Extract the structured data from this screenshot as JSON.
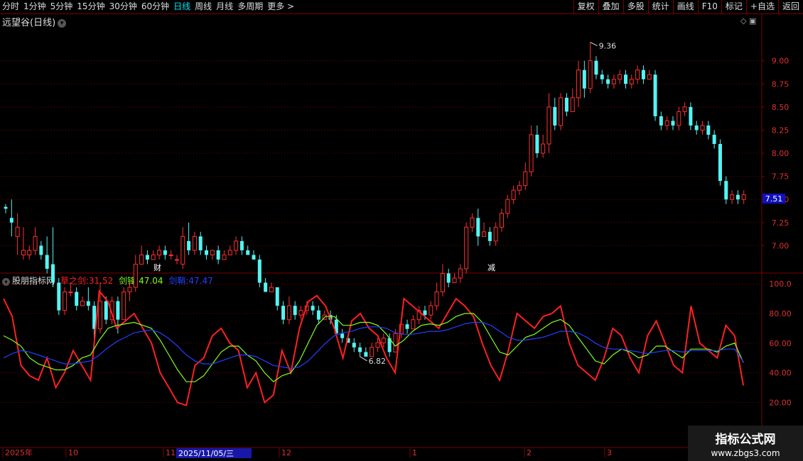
{
  "toolbar": {
    "periods": [
      "分时",
      "1分钟",
      "5分钟",
      "15分钟",
      "30分钟",
      "60分钟",
      "日线",
      "周线",
      "月线",
      "多周期",
      "更多 >"
    ],
    "active_period": "日线",
    "tools": [
      "复权",
      "叠加",
      "多股",
      "统计",
      "画线",
      "F10",
      "标记",
      "+自选",
      "返回"
    ]
  },
  "stock": {
    "title": "远望谷(日线)",
    "current_price": "7.51",
    "high_label": "9.36",
    "low_label": "6.82"
  },
  "markers": {
    "cai": "财",
    "jian": "减"
  },
  "indicator": {
    "name": "股朋指标网",
    "lines": [
      {
        "label": "草之剑:",
        "value": "31.52",
        "color": "#ff2020"
      },
      {
        "label": "剑锋:",
        "value": "47.04",
        "color": "#80ff20"
      },
      {
        "label": "剑鞘:",
        "value": "47.47",
        "color": "#2040ff"
      }
    ]
  },
  "price_axis": [
    "9.00",
    "8.75",
    "8.50",
    "8.25",
    "8.00",
    "7.75",
    "7.50",
    "7.25",
    "7.00"
  ],
  "ind_axis": [
    "100.0",
    "80.00",
    "60.00",
    "40.00",
    "20.00"
  ],
  "date_axis": {
    "labels": [
      "2025年",
      "10",
      "11",
      "12",
      "1",
      "2",
      "3"
    ],
    "cursor_date": "2025/11/05/三"
  },
  "watermark": {
    "line1": "指标公式网",
    "line2": "www.zbgs3.com"
  },
  "colors": {
    "up": "#ff3030",
    "down": "#54f4f4",
    "grid": "#7a0000",
    "line_fast": "#ff2020",
    "line_mid": "#80ff20",
    "line_slow": "#2040ff"
  },
  "chart_data": {
    "type": "candlestick",
    "candles": [
      [
        7.42,
        7.4,
        7.45,
        7.35
      ],
      [
        7.3,
        7.25,
        7.5,
        7.1
      ],
      [
        7.1,
        7.2,
        7.35,
        6.9
      ],
      [
        6.9,
        6.95,
        7.2,
        6.85
      ],
      [
        6.9,
        6.95,
        7.0,
        6.85
      ],
      [
        6.95,
        7.1,
        7.2,
        6.9
      ],
      [
        7.0,
        6.9,
        7.05,
        6.85
      ],
      [
        6.9,
        6.75,
        7.1,
        6.7
      ],
      [
        6.8,
        6.6,
        7.2,
        6.55
      ],
      [
        6.6,
        6.3,
        6.65,
        6.25
      ],
      [
        6.3,
        6.5,
        6.55,
        6.25
      ],
      [
        6.5,
        6.5,
        6.6,
        6.45
      ],
      [
        6.5,
        6.35,
        6.55,
        6.3
      ],
      [
        6.35,
        6.4,
        6.45,
        6.35
      ],
      [
        6.4,
        6.35,
        6.55,
        6.3
      ],
      [
        6.35,
        6.1,
        6.4,
        5.95
      ],
      [
        6.1,
        6.4,
        6.6,
        6.05
      ],
      [
        6.4,
        6.2,
        6.45,
        6.15
      ],
      [
        6.2,
        6.4,
        6.45,
        6.15
      ],
      [
        6.4,
        6.2,
        6.45,
        6.05
      ],
      [
        6.2,
        6.5,
        6.55,
        6.2
      ],
      [
        6.5,
        6.55,
        6.6,
        6.4
      ],
      [
        6.55,
        6.8,
        6.9,
        6.5
      ],
      [
        6.8,
        6.9,
        7.0,
        6.8
      ],
      [
        6.9,
        6.85,
        6.95,
        6.8
      ],
      [
        6.85,
        6.9,
        6.95,
        6.85
      ],
      [
        6.9,
        6.95,
        7.0,
        6.85
      ],
      [
        6.95,
        6.9,
        7.0,
        6.85
      ],
      [
        6.9,
        6.9,
        6.95,
        6.85
      ],
      [
        6.85,
        6.85,
        6.9,
        6.8
      ],
      [
        6.8,
        7.1,
        7.2,
        6.75
      ],
      [
        7.05,
        6.95,
        7.25,
        6.9
      ],
      [
        6.95,
        7.1,
        7.15,
        6.9
      ],
      [
        7.1,
        6.95,
        7.15,
        6.9
      ],
      [
        6.95,
        6.9,
        7.0,
        6.85
      ],
      [
        6.9,
        6.95,
        6.95,
        6.85
      ],
      [
        6.95,
        6.85,
        7.0,
        6.8
      ],
      [
        6.85,
        6.9,
        6.95,
        6.85
      ],
      [
        6.9,
        6.95,
        7.0,
        6.9
      ],
      [
        6.95,
        7.05,
        7.1,
        6.9
      ],
      [
        7.05,
        6.95,
        7.1,
        6.9
      ],
      [
        6.95,
        6.9,
        7.0,
        6.9
      ],
      [
        6.9,
        6.85,
        6.95,
        6.85
      ],
      [
        6.85,
        6.6,
        6.9,
        6.55
      ],
      [
        6.6,
        6.5,
        6.65,
        6.5
      ],
      [
        6.5,
        6.55,
        6.6,
        6.5
      ],
      [
        6.55,
        6.35,
        6.55,
        6.3
      ],
      [
        6.35,
        6.2,
        6.4,
        6.15
      ],
      [
        6.2,
        6.35,
        6.45,
        6.15
      ],
      [
        6.35,
        6.25,
        6.4,
        6.2
      ],
      [
        6.25,
        6.3,
        6.35,
        6.2
      ],
      [
        6.3,
        6.35,
        6.4,
        6.25
      ],
      [
        6.35,
        6.3,
        6.4,
        6.25
      ],
      [
        6.3,
        6.2,
        6.35,
        6.15
      ],
      [
        6.2,
        6.25,
        6.3,
        6.2
      ],
      [
        6.25,
        6.2,
        6.3,
        6.15
      ],
      [
        6.2,
        6.05,
        6.25,
        6.05
      ],
      [
        6.05,
        6.0,
        6.1,
        5.95
      ],
      [
        6.0,
        5.95,
        6.05,
        5.95
      ],
      [
        5.95,
        5.9,
        6.0,
        5.85
      ],
      [
        5.9,
        5.85,
        5.95,
        5.8
      ],
      [
        5.85,
        5.8,
        5.9,
        5.8
      ],
      [
        5.8,
        5.9,
        5.95,
        5.8
      ],
      [
        5.9,
        5.95,
        6.0,
        5.85
      ],
      [
        5.95,
        6.0,
        6.05,
        5.9
      ],
      [
        6.0,
        5.85,
        6.05,
        5.8
      ],
      [
        5.85,
        6.05,
        6.1,
        5.85
      ],
      [
        6.05,
        6.15,
        6.2,
        6.0
      ],
      [
        6.15,
        6.1,
        6.2,
        6.05
      ],
      [
        6.1,
        6.2,
        6.25,
        6.1
      ],
      [
        6.2,
        6.3,
        6.35,
        6.15
      ],
      [
        6.3,
        6.25,
        6.35,
        6.2
      ],
      [
        6.25,
        6.35,
        6.4,
        6.2
      ],
      [
        6.35,
        6.5,
        6.6,
        6.3
      ],
      [
        6.5,
        6.7,
        6.8,
        6.45
      ],
      [
        6.7,
        6.6,
        6.75,
        6.55
      ],
      [
        6.6,
        6.65,
        6.7,
        6.6
      ],
      [
        6.65,
        6.75,
        6.8,
        6.6
      ],
      [
        6.75,
        7.2,
        7.25,
        6.7
      ],
      [
        7.2,
        7.3,
        7.35,
        7.15
      ],
      [
        7.3,
        7.1,
        7.4,
        7.0
      ],
      [
        7.1,
        7.15,
        7.25,
        7.1
      ],
      [
        7.15,
        7.05,
        7.2,
        7.0
      ],
      [
        7.05,
        7.2,
        7.25,
        7.0
      ],
      [
        7.2,
        7.35,
        7.4,
        7.15
      ],
      [
        7.35,
        7.5,
        7.55,
        7.3
      ],
      [
        7.5,
        7.6,
        7.65,
        7.45
      ],
      [
        7.6,
        7.65,
        7.7,
        7.55
      ],
      [
        7.65,
        7.8,
        7.9,
        7.6
      ],
      [
        7.8,
        8.2,
        8.3,
        7.75
      ],
      [
        8.2,
        8.0,
        8.3,
        7.95
      ],
      [
        8.0,
        8.1,
        8.2,
        7.95
      ],
      [
        8.1,
        8.5,
        8.65,
        8.0
      ],
      [
        8.5,
        8.3,
        8.6,
        8.25
      ],
      [
        8.3,
        8.6,
        8.65,
        8.25
      ],
      [
        8.6,
        8.45,
        8.65,
        8.4
      ],
      [
        8.45,
        8.6,
        8.7,
        8.45
      ],
      [
        8.6,
        8.9,
        9.0,
        8.5
      ],
      [
        8.9,
        8.7,
        9.0,
        8.6
      ],
      [
        8.7,
        9.0,
        9.2,
        8.65
      ],
      [
        9.0,
        8.85,
        9.05,
        8.8
      ],
      [
        8.85,
        8.8,
        8.9,
        8.75
      ],
      [
        8.8,
        8.75,
        8.85,
        8.7
      ],
      [
        8.75,
        8.8,
        8.85,
        8.7
      ],
      [
        8.8,
        8.85,
        8.9,
        8.75
      ],
      [
        8.85,
        8.75,
        8.9,
        8.7
      ],
      [
        8.75,
        8.8,
        8.85,
        8.7
      ],
      [
        8.8,
        8.9,
        8.95,
        8.75
      ],
      [
        8.9,
        8.8,
        8.95,
        8.75
      ],
      [
        8.8,
        8.85,
        8.9,
        8.8
      ],
      [
        8.85,
        8.4,
        8.9,
        8.35
      ],
      [
        8.4,
        8.3,
        8.45,
        8.25
      ],
      [
        8.3,
        8.35,
        8.4,
        8.25
      ],
      [
        8.35,
        8.3,
        8.4,
        8.25
      ],
      [
        8.3,
        8.45,
        8.5,
        8.25
      ],
      [
        8.45,
        8.5,
        8.55,
        8.4
      ],
      [
        8.5,
        8.3,
        8.55,
        8.25
      ],
      [
        8.3,
        8.25,
        8.35,
        8.2
      ],
      [
        8.25,
        8.3,
        8.35,
        8.2
      ],
      [
        8.3,
        8.2,
        8.35,
        8.15
      ],
      [
        8.2,
        8.1,
        8.25,
        8.05
      ],
      [
        8.1,
        7.7,
        8.15,
        7.65
      ],
      [
        7.7,
        7.5,
        7.75,
        7.45
      ],
      [
        7.5,
        7.55,
        7.6,
        7.45
      ],
      [
        7.55,
        7.5,
        7.6,
        7.45
      ],
      [
        7.5,
        7.55,
        7.6,
        7.45
      ]
    ],
    "indicator_series": {
      "草之剑": [
        90,
        78,
        45,
        38,
        35,
        50,
        30,
        40,
        55,
        45,
        35,
        95,
        88,
        70,
        75,
        80,
        70,
        60,
        40,
        30,
        20,
        18,
        45,
        50,
        65,
        70,
        60,
        55,
        30,
        40,
        20,
        25,
        55,
        40,
        70,
        88,
        92,
        85,
        70,
        50,
        75,
        80,
        70,
        65,
        50,
        40,
        90,
        85,
        80,
        75,
        70,
        80,
        90,
        85,
        78,
        60,
        45,
        35,
        55,
        80,
        75,
        70,
        78,
        80,
        85,
        60,
        45,
        40,
        35,
        50,
        70,
        65,
        50,
        40,
        65,
        75,
        60,
        45,
        40,
        85,
        60,
        55,
        50,
        72,
        65,
        31.52
      ],
      "剑锋": [
        65,
        62,
        58,
        50,
        46,
        44,
        42,
        42,
        45,
        50,
        52,
        62,
        70,
        72,
        73,
        74,
        72,
        70,
        62,
        52,
        42,
        34,
        34,
        38,
        46,
        54,
        58,
        58,
        52,
        48,
        40,
        34,
        38,
        40,
        48,
        60,
        72,
        78,
        78,
        72,
        72,
        74,
        74,
        72,
        66,
        58,
        62,
        68,
        72,
        73,
        72,
        74,
        78,
        80,
        80,
        74,
        64,
        54,
        52,
        58,
        64,
        66,
        70,
        74,
        76,
        72,
        64,
        56,
        48,
        46,
        52,
        56,
        54,
        50,
        52,
        58,
        58,
        54,
        50,
        56,
        56,
        56,
        54,
        58,
        60,
        47.04
      ],
      "剑鞘": [
        50,
        53,
        55,
        54,
        52,
        50,
        48,
        46,
        46,
        47,
        48,
        52,
        57,
        61,
        64,
        67,
        68,
        69,
        67,
        63,
        58,
        52,
        48,
        46,
        46,
        48,
        50,
        52,
        52,
        51,
        48,
        45,
        44,
        43,
        44,
        48,
        54,
        60,
        65,
        67,
        68,
        70,
        71,
        71,
        70,
        67,
        66,
        66,
        67,
        68,
        68,
        69,
        71,
        73,
        74,
        74,
        72,
        68,
        64,
        62,
        62,
        63,
        64,
        66,
        68,
        68,
        67,
        64,
        60,
        57,
        56,
        56,
        55,
        54,
        53,
        54,
        55,
        55,
        54,
        55,
        55,
        55,
        55,
        56,
        56,
        47.47
      ]
    },
    "price_range": [
      6.82,
      9.36
    ],
    "ind_range": [
      0,
      100
    ]
  }
}
